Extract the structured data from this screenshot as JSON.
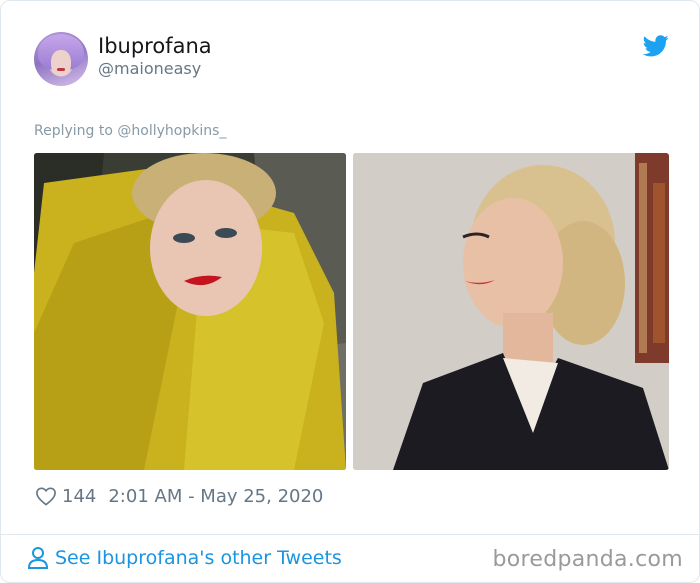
{
  "tweet": {
    "author_name": "Ibuprofana",
    "author_handle": "@maioneasy",
    "reply_context": "Replying to @hollyhopkins_",
    "likes": "144",
    "timestamp": "2:01 AM - May 25, 2020"
  },
  "footer": {
    "see_more": "See Ibuprofana's other Tweets",
    "watermark": "boredpanda.com"
  },
  "icons": {
    "brand": "twitter-bird-icon",
    "like": "heart-icon",
    "profile": "person-icon"
  },
  "colors": {
    "twitter_blue": "#1da1f2",
    "link_blue": "#1b95e0",
    "secondary_text": "#657786"
  }
}
